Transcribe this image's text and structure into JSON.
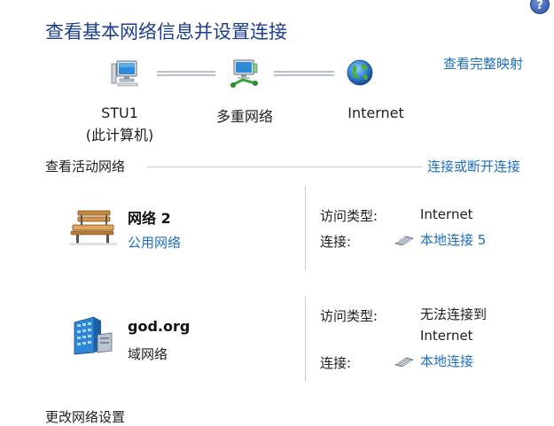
{
  "header": {
    "title": "查看基本网络信息并设置连接",
    "full_map_link": "查看完整映射",
    "help_glyph": "?"
  },
  "topology": {
    "nodes": [
      {
        "icon": "computer-icon",
        "line1": "STU1",
        "line2": "(此计算机)"
      },
      {
        "icon": "multiple-networks-icon",
        "line1": "多重网络",
        "line2": ""
      },
      {
        "icon": "internet-globe-icon",
        "line1": "Internet",
        "line2": ""
      }
    ]
  },
  "active_networks": {
    "section_label": "查看活动网络",
    "connect_link": "连接或断开连接",
    "networks": [
      {
        "icon": "public-network-bench-icon",
        "name": "网络  2",
        "type": "公用网络",
        "type_is_link": true,
        "access_label": "访问类型:",
        "access_value_line1": "Internet",
        "access_value_line2": "",
        "conn_label": "连接:",
        "conn_value": "本地连接 5"
      },
      {
        "icon": "domain-network-building-icon",
        "name": "god.org",
        "type": "域网络",
        "type_is_link": false,
        "access_label": "访问类型:",
        "access_value_line1": "无法连接到",
        "access_value_line2": "Internet",
        "conn_label": "连接:",
        "conn_value": "本地连接"
      }
    ]
  },
  "footer": {
    "change_settings_label": "更改网络设置"
  }
}
